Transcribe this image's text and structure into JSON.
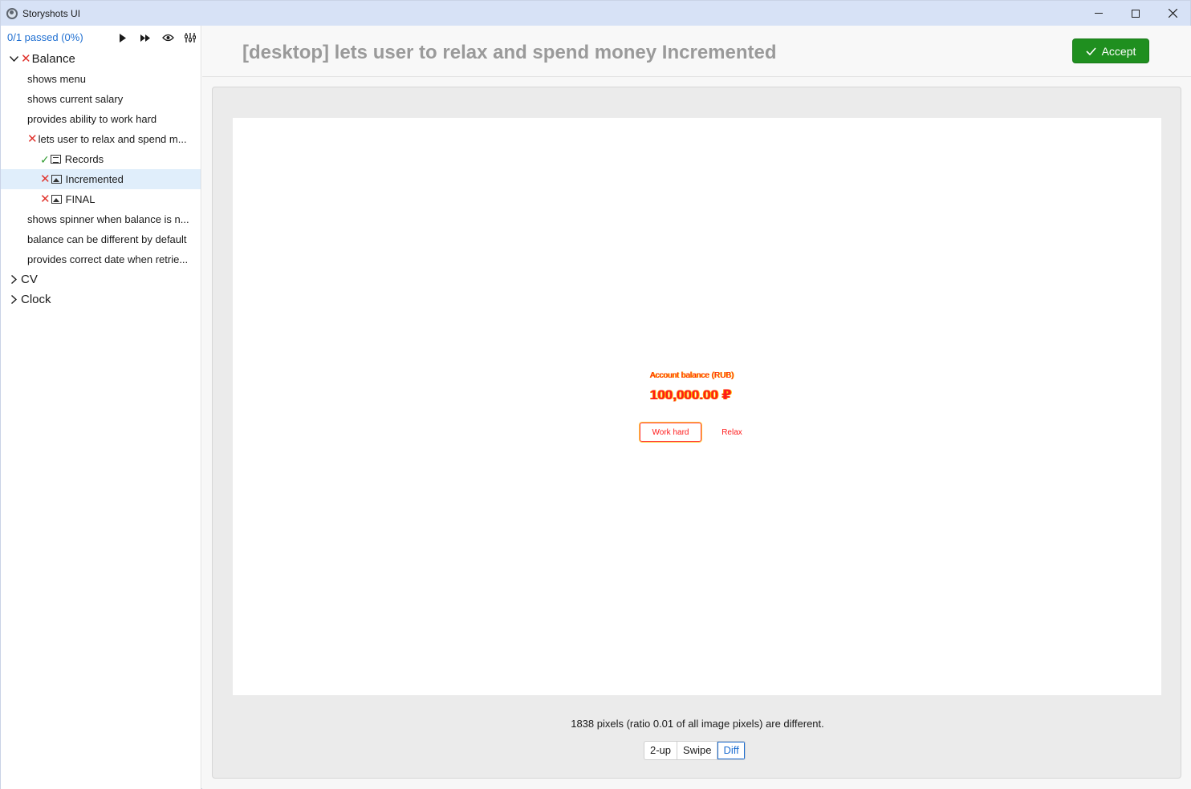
{
  "window": {
    "title": "Storyshots UI"
  },
  "toolbar": {
    "passed_text": "0/1 passed (0%)"
  },
  "tree": {
    "balance": {
      "label": "Balance",
      "items": [
        "shows menu",
        "shows current salary",
        "provides ability to work hard",
        "lets user to relax and spend m...",
        "shows spinner when balance is n...",
        "balance can be different by default",
        "provides correct date when retrie..."
      ],
      "sub": [
        "Records",
        "Incremented",
        "FINAL"
      ]
    },
    "cv": {
      "label": "CV"
    },
    "clock": {
      "label": "Clock"
    }
  },
  "header": {
    "title": "[desktop] lets user to relax and spend money Incremented",
    "accept_label": "Accept"
  },
  "diff": {
    "caption": "Account balance (RUB)",
    "amount": "100,000.00 ₽",
    "button1": "Work hard",
    "button2": "Relax",
    "status": "1838 pixels (ratio 0.01 of all image pixels) are different."
  },
  "modes": [
    "2-up",
    "Swipe",
    "Diff"
  ],
  "colors": {
    "accent": "#1f6fd1",
    "accept": "#1f8f1f",
    "fail": "#e0332d",
    "pass": "#2e9a2e",
    "selected": "#e0eefb"
  }
}
